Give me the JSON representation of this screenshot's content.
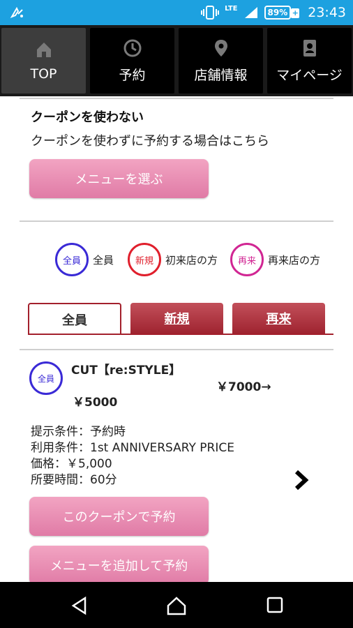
{
  "status": {
    "network": "LTE",
    "battery": "89%",
    "battery_plus": "+",
    "time": "23:43"
  },
  "nav": [
    {
      "label": "TOP",
      "icon": "home-icon"
    },
    {
      "label": "予約",
      "icon": "clock-icon"
    },
    {
      "label": "店舗情報",
      "icon": "location-pin-icon"
    },
    {
      "label": "マイページ",
      "icon": "id-card-icon"
    }
  ],
  "no_coupon": {
    "title": "クーポンを使わない",
    "desc": "クーポンを使わずに予約する場合はこちら",
    "button": "メニューを選ぶ"
  },
  "legend": [
    {
      "badge": "全員",
      "label": "全員",
      "color": "#3a2ad6"
    },
    {
      "badge": "新規",
      "label": "初来店の方",
      "color": "#e01f2c"
    },
    {
      "badge": "再来",
      "label": "再来店の方",
      "color": "#d12693"
    }
  ],
  "tabs": [
    "全員",
    "新規",
    "再来"
  ],
  "coupon": {
    "badge": "全員",
    "title": "CUT【re:STYLE】",
    "original_price": "￥7000→",
    "price": "￥5000",
    "details": [
      "提示条件：予約時",
      "利用条件：1st ANNIVERSARY PRICE",
      "価格：￥5,000",
      "所要時間：60分"
    ],
    "button_reserve": "このクーポンで予約",
    "button_add_menu": "メニューを追加して予約"
  },
  "colors": {
    "statusbar": "#1da1e0",
    "accent": "#a3202c",
    "pink": "#e07ba6"
  }
}
